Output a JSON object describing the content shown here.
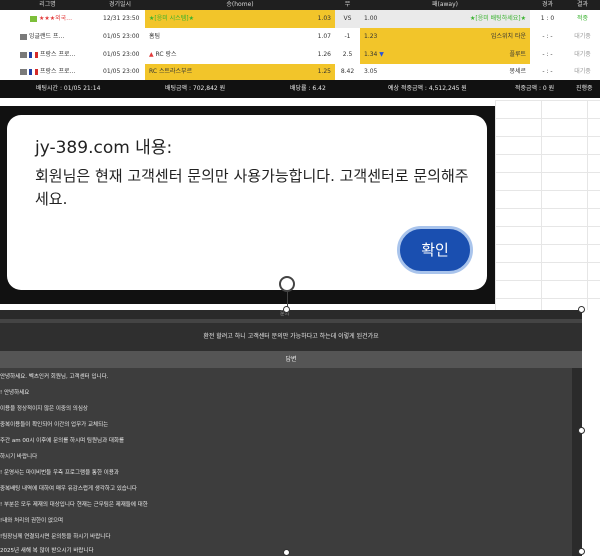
{
  "table": {
    "headers": [
      "리그명",
      "경기일시",
      "승(home)",
      "무",
      "패(away)",
      "경과",
      "결과"
    ],
    "rows": [
      {
        "league": "★★★외국…",
        "datetime": "12/31 23:50",
        "home": "★[응미 시스템]★",
        "home_odds": "1.03",
        "draw": "VS",
        "away_odds": "1.00",
        "away": "★[응미 배팅하세요]★",
        "score": "1 : 0",
        "result": "적중"
      },
      {
        "league": "잉글랜드 프…",
        "datetime": "01/05 23:00",
        "home": "홈팀",
        "home_odds": "1.07",
        "draw": "-1",
        "away_odds": "1.23",
        "away": "입스위치 타운",
        "score": "- : -",
        "result": "대기중"
      },
      {
        "league": "프랑스 프로…",
        "datetime": "01/05 23:00",
        "home": "RC 랑스",
        "home_odds": "1.26",
        "draw": "2.5",
        "away_odds": "1.34",
        "away": "플루트",
        "score": "- : -",
        "result": "대기중"
      },
      {
        "league": "프랑스 프로…",
        "datetime": "01/05 23:00",
        "home": "RC 스트라스부르",
        "home_odds": "1.25",
        "draw": "8.42",
        "away_odds": "3.05",
        "away": "몽세르",
        "score": "- : -",
        "result": "대기중"
      }
    ],
    "footer": {
      "bet_time": "배팅시간 : 01/05 21:14",
      "bet_amount": "배팅금액 : 702,842 원",
      "bet_odds": "배당률 : 6.42",
      "expected": "예상 적중금액 : 4,512,245 원",
      "won": "적중금액 : 0 원",
      "status": "진행중"
    }
  },
  "dialog": {
    "title": "jy-389.com 내용:",
    "message": "회원님은 현재 고객센터 문의만 사용가능합니다. 고객센터로 문의해주세요.",
    "ok_label": "확인"
  },
  "chat": {
    "top_label": "문의",
    "question": "환전 할려고 하니 고객센터 문의만 가능하다고 하는데 이렇게 된건가요",
    "answer_label": "답변",
    "lines": [
      "안녕하세요. 벡츠인커 회원님, 고객센터 입니다.",
      "! 안녕하세요",
      "이용을 정상적이지 않은 이중의 의심상",
      "중복이용들이 확인되어 이간의 업무가 교체되는",
      "주간 am 00시 이후에 문의를 하시며 팀원님과 대화를",
      "하시기 바랍니다",
      "! 운영사는 마이비번들 우측 프로그램을 통한 이용과",
      "중복배팅 내역에 대하여 매우 유감스럽게 생각하고 있습니다",
      "! 부분은 모두 제재의 대상입니다 현재는 근무팀은 제재들에 대한",
      "!내와 처리의 권한이 없으며",
      "!팀장님께 연결되시면 문의등을 하시기 바랍니다",
      "2025년 새해 복 많이 받으시기 바랍니다"
    ]
  },
  "colors": {
    "highlight": "#f2c52a",
    "dialog_button": "#1a4fb0",
    "panel": "#444444"
  }
}
